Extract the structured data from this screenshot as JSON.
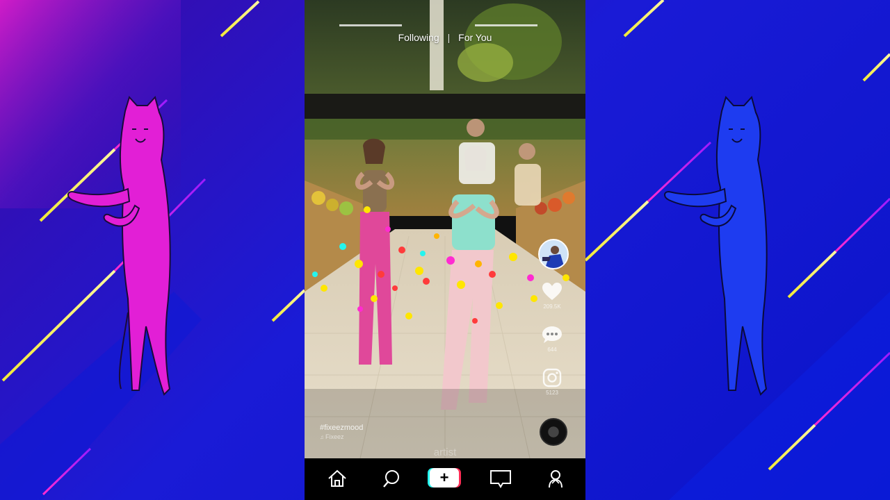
{
  "feed": {
    "tabs": [
      {
        "label": "Following",
        "active": false
      },
      {
        "label": "For You",
        "active": true
      }
    ],
    "separator": "|"
  },
  "actions": {
    "like_count": "209.5K",
    "comment_count": "644",
    "share_count": "5123"
  },
  "caption": {
    "hashtag": "#fixeezmood",
    "sound": "Fixeez",
    "watermark": "artist"
  },
  "nav": {
    "items": [
      {
        "name": "home",
        "icon": "home-icon"
      },
      {
        "name": "discover",
        "icon": "search-icon"
      },
      {
        "name": "create",
        "icon": "plus-icon"
      },
      {
        "name": "inbox",
        "icon": "message-icon"
      },
      {
        "name": "profile",
        "icon": "person-icon"
      }
    ],
    "create_symbol": "+"
  },
  "colors": {
    "background": "#1a1bd6",
    "cat_left": "#e21fd6",
    "cat_right": "#1e3cf0",
    "accent_cyan": "#25f4ee",
    "accent_red": "#fe2c55",
    "stripe_yellow": "#f2ea38"
  }
}
